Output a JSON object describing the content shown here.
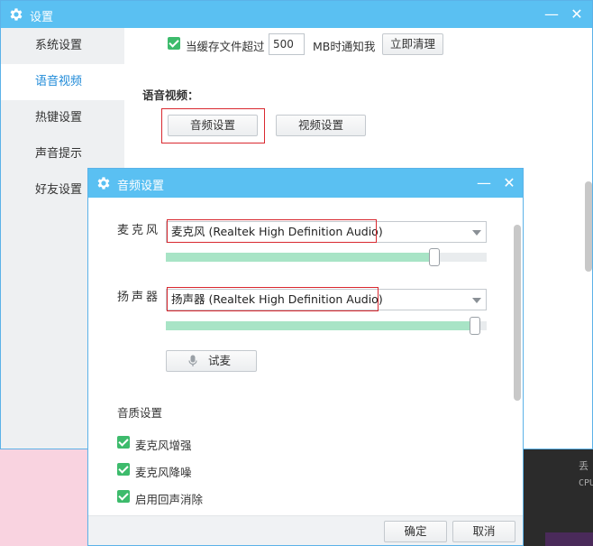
{
  "main_window": {
    "title": "设置",
    "sidebar": {
      "items": [
        {
          "label": "系统设置",
          "active": false
        },
        {
          "label": "语音视频",
          "active": true
        },
        {
          "label": "热键设置",
          "active": false
        },
        {
          "label": "声音提示",
          "active": false
        },
        {
          "label": "好友设置",
          "active": false
        }
      ]
    },
    "cache_row": {
      "checked": true,
      "label_before": "当缓存文件超过",
      "value": "500",
      "label_after": "MB时通知我",
      "clear_button": "立即清理"
    },
    "voice_video": {
      "title": "语音视频：",
      "audio_button": "音频设置",
      "video_button": "视频设置"
    }
  },
  "dialog": {
    "title": "音频设置",
    "microphone": {
      "label": "麦克风",
      "selected": "麦克风 (Realtek High Definition Audio)",
      "level": 0.85
    },
    "speaker": {
      "label": "扬声器",
      "selected": "扬声器 (Realtek High Definition Audio)",
      "level": 0.98
    },
    "test_button": "试麦",
    "quality_title": "音质设置",
    "options": [
      {
        "label": "麦克风增强",
        "checked": true
      },
      {
        "label": "麦克风降噪",
        "checked": true
      },
      {
        "label": "启用回声消除",
        "checked": true
      }
    ],
    "ok_button": "确定",
    "cancel_button": "取消"
  },
  "background": {
    "text_1": "丢",
    "text_2": "CPU"
  },
  "colors": {
    "titlebar": "#5ac0f2",
    "active_sidebar_text": "#1f8ad8",
    "checkbox": "#3dbb6c",
    "slider_fill": "#a8e4c6",
    "highlight_frame": "#d9282f"
  }
}
